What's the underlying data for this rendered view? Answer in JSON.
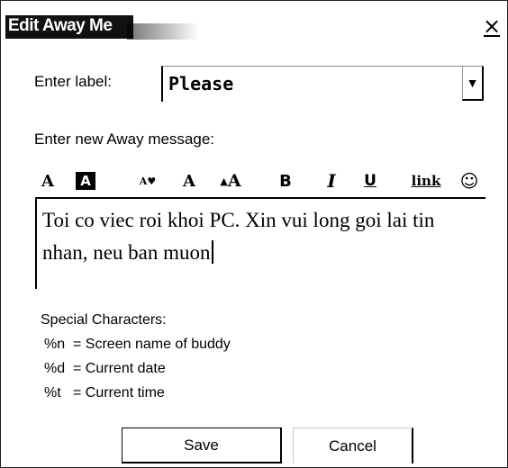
{
  "window": {
    "title": "Edit Away Me",
    "close_glyph": "×"
  },
  "label_field": {
    "caption": "Enter label:",
    "value": "Please",
    "dropdown_icon": "chevron-down-icon"
  },
  "message": {
    "caption": "Enter new Away message:",
    "text": "Toi co viec roi khoi PC. Xin vui long goi lai tin nhan, neu ban muon"
  },
  "toolbar": {
    "items": [
      {
        "name": "text-color-icon",
        "glyph": "A"
      },
      {
        "name": "background-color-icon",
        "glyph": "A"
      },
      {
        "name": "decrease-font-size-icon",
        "glyph": "A▾"
      },
      {
        "name": "normal-font-size-icon",
        "glyph": "A"
      },
      {
        "name": "increase-font-size-icon",
        "glyph": "▴A"
      },
      {
        "name": "bold-icon",
        "glyph": "B"
      },
      {
        "name": "italic-icon",
        "glyph": "I"
      },
      {
        "name": "underline-icon",
        "glyph": "U"
      },
      {
        "name": "link-icon",
        "glyph": "link"
      },
      {
        "name": "smiley-icon",
        "glyph": "☺"
      }
    ]
  },
  "special_characters": {
    "heading": "Special Characters:",
    "items": [
      "%n  = Screen name of buddy",
      "%d  = Current date",
      "%t   = Current time"
    ]
  },
  "buttons": {
    "save": "Save",
    "cancel": "Cancel"
  }
}
